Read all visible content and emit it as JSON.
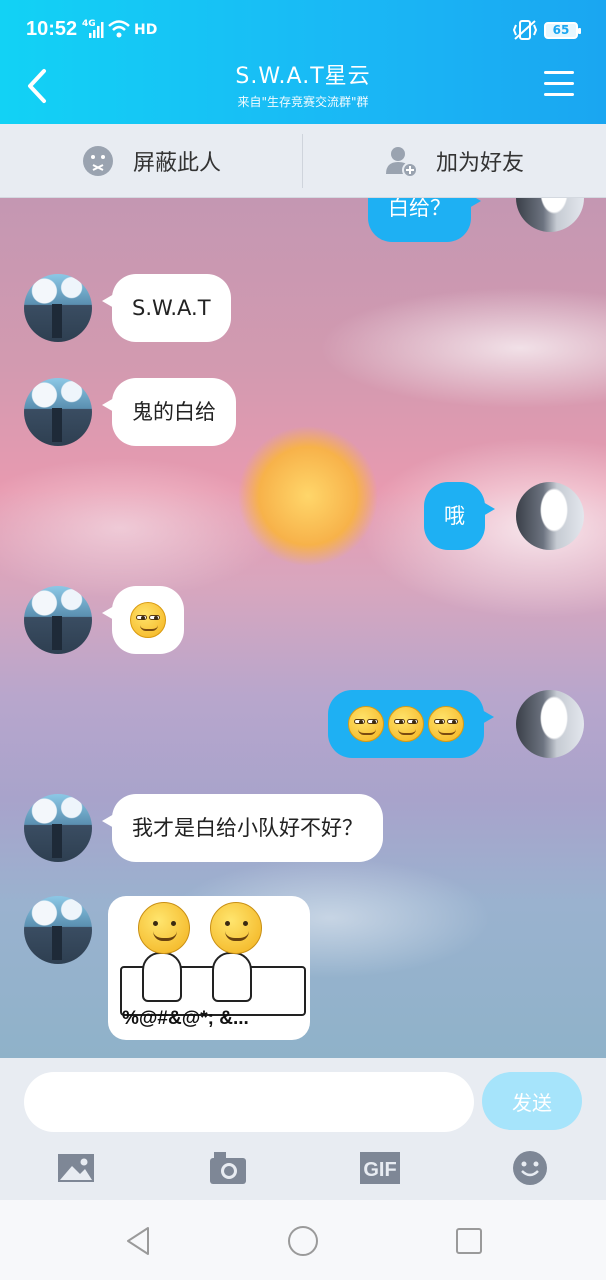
{
  "status_bar": {
    "time": "10:52",
    "network": "4G",
    "hd": "HD",
    "battery": "65"
  },
  "header": {
    "title": "S.W.A.T星云",
    "subtitle": "来自\"生存竞赛交流群\"群"
  },
  "actions": {
    "block_label": "屏蔽此人",
    "add_friend_label": "加为好友"
  },
  "messages": [
    {
      "side": "out",
      "text": "白给？"
    },
    {
      "side": "in",
      "text": "S.W.A.T"
    },
    {
      "side": "in",
      "text": "鬼的白给"
    },
    {
      "side": "out",
      "text": "哦"
    },
    {
      "side": "in",
      "emoji_count": 1,
      "icon": "smirk-emoji-icon"
    },
    {
      "side": "out",
      "emoji_count": 3,
      "icon": "smirk-emoji-icon"
    },
    {
      "side": "in",
      "text": "我才是白给小队好不好？"
    },
    {
      "side": "in",
      "sticker_text": "%@#&@*;  &..."
    }
  ],
  "input": {
    "value": "",
    "placeholder": "",
    "send_label": "发送"
  },
  "toolbar_icons": [
    "image-icon",
    "camera-icon",
    "gif-icon",
    "emoji-icon"
  ],
  "gif_label": "GIF",
  "colors": {
    "header": "#1ab7f5",
    "out_bubble": "#1eb0f3",
    "send_button": "#a6e4fb"
  }
}
